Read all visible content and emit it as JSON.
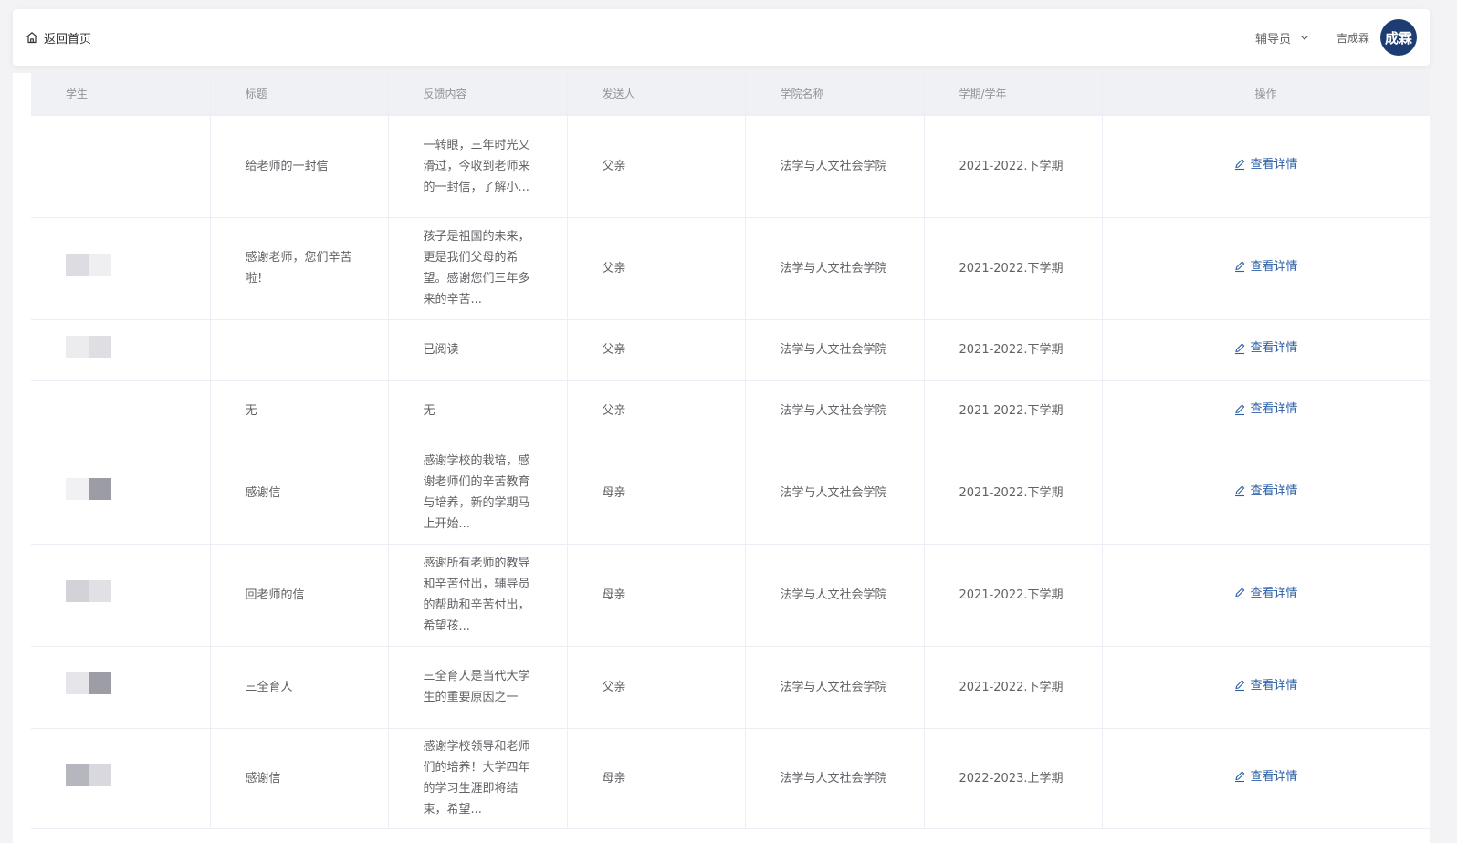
{
  "header": {
    "back_label": "返回首页",
    "role": "辅导员",
    "username": "吉成霖",
    "avatar_text": "成霖",
    "avatar_color": "#1d3d72"
  },
  "table": {
    "columns": [
      "学生",
      "标题",
      "反馈内容",
      "发送人",
      "学院名称",
      "学期/学年",
      "操作"
    ],
    "action_label": "查看详情",
    "rows": [
      {
        "title": "给老师的一封信",
        "content": "一转眼，三年时光又滑过，今收到老师来的一封信，了解小...",
        "sender": "父亲",
        "college": "法学与人文社会学院",
        "term": "2021-2022.下学期",
        "thumb": [
          "#ffffff",
          "#ffffff"
        ]
      },
      {
        "title": "感谢老师，您们辛苦啦！",
        "content": "孩子是祖国的未来，更是我们父母的希望。感谢您们三年多来的辛苦...",
        "sender": "父亲",
        "college": "法学与人文社会学院",
        "term": "2021-2022.下学期",
        "thumb": [
          "#dcdce2",
          "#efeff2"
        ]
      },
      {
        "title": "",
        "content": "已阅读",
        "sender": "父亲",
        "college": "法学与人文社会学院",
        "term": "2021-2022.下学期",
        "thumb": [
          "#ececef",
          "#dedee3"
        ]
      },
      {
        "title": "无",
        "content": "无",
        "sender": "父亲",
        "college": "法学与人文社会学院",
        "term": "2021-2022.下学期",
        "thumb": [
          "#ffffff",
          "#ffffff"
        ]
      },
      {
        "title": "感谢信",
        "content": "感谢学校的栽培，感谢老师们的辛苦教育与培养，新的学期马上开始...",
        "sender": "母亲",
        "college": "法学与人文社会学院",
        "term": "2021-2022.下学期",
        "thumb": [
          "#f1f1f4",
          "#9c9ca4"
        ]
      },
      {
        "title": "回老师的信",
        "content": "感谢所有老师的教导和辛苦付出，辅导员的帮助和辛苦付出，希望孩...",
        "sender": "母亲",
        "college": "法学与人文社会学院",
        "term": "2021-2022.下学期",
        "thumb": [
          "#d2d2d8",
          "#e0e0e5"
        ]
      },
      {
        "title": "三全育人",
        "content": "三全育人是当代大学生的重要原因之一",
        "sender": "父亲",
        "college": "法学与人文社会学院",
        "term": "2021-2022.下学期",
        "thumb": [
          "#e6e6ea",
          "#9d9da5"
        ]
      },
      {
        "title": "感谢信",
        "content": "感谢学校领导和老师们的培养！大学四年的学习生涯即将结束，希望...",
        "sender": "母亲",
        "college": "法学与人文社会学院",
        "term": "2022-2023.上学期",
        "thumb": [
          "#b6b6bf",
          "#d8d8de"
        ]
      }
    ]
  }
}
